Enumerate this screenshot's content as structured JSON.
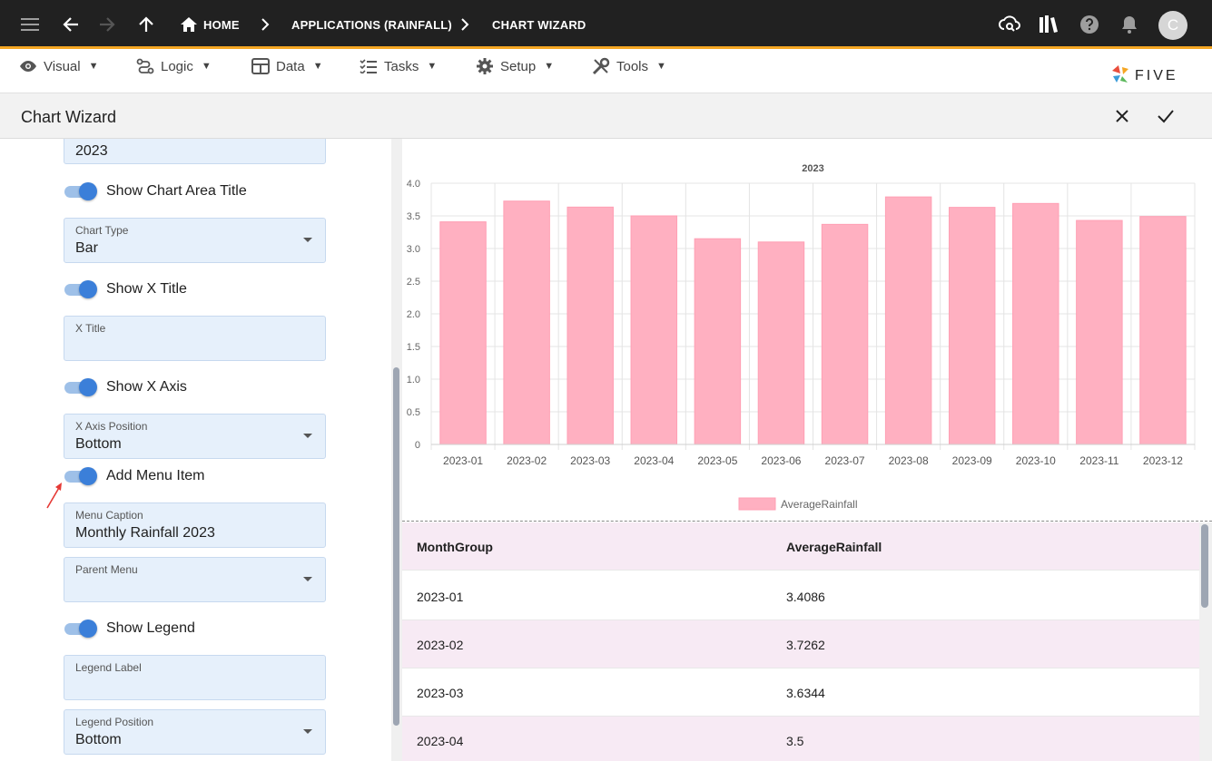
{
  "topbar": {
    "breadcrumbs": [
      "HOME",
      "APPLICATIONS (RAINFALL)",
      "CHART WIZARD"
    ],
    "avatar_letter": "C",
    "accent_color": "#f5a623"
  },
  "menubar": {
    "items": [
      {
        "label": "Visual",
        "icon": "eye-icon"
      },
      {
        "label": "Logic",
        "icon": "logic-icon"
      },
      {
        "label": "Data",
        "icon": "table-icon"
      },
      {
        "label": "Tasks",
        "icon": "tasks-icon"
      },
      {
        "label": "Setup",
        "icon": "gear-icon"
      },
      {
        "label": "Tools",
        "icon": "tools-icon"
      }
    ],
    "logo_text": "FIVE"
  },
  "titlebar": {
    "title": "Chart Wizard"
  },
  "form": {
    "chart_area_title_value": "2023",
    "show_chart_area_title": {
      "label": "Show Chart Area Title",
      "on": true
    },
    "chart_type": {
      "label": "Chart Type",
      "value": "Bar"
    },
    "show_x_title": {
      "label": "Show X Title",
      "on": true
    },
    "x_title": {
      "label": "X Title",
      "value": ""
    },
    "show_x_axis": {
      "label": "Show X Axis",
      "on": true
    },
    "x_axis_position": {
      "label": "X Axis Position",
      "value": "Bottom"
    },
    "add_menu_item": {
      "label": "Add Menu Item",
      "on": true
    },
    "menu_caption": {
      "label": "Menu Caption",
      "value": "Monthly Rainfall 2023"
    },
    "parent_menu": {
      "label": "Parent Menu",
      "value": ""
    },
    "show_legend": {
      "label": "Show Legend",
      "on": true
    },
    "legend_label": {
      "label": "Legend Label",
      "value": ""
    },
    "legend_position": {
      "label": "Legend Position",
      "value": "Bottom"
    }
  },
  "chart_data": {
    "type": "bar",
    "title": "2023",
    "categories": [
      "2023-01",
      "2023-02",
      "2023-03",
      "2023-04",
      "2023-05",
      "2023-06",
      "2023-07",
      "2023-08",
      "2023-09",
      "2023-10",
      "2023-11",
      "2023-12"
    ],
    "series": [
      {
        "name": "AverageRainfall",
        "values": [
          3.4086,
          3.7262,
          3.6344,
          3.5,
          3.15,
          3.1,
          3.37,
          3.79,
          3.63,
          3.69,
          3.43,
          3.49
        ],
        "color": "#ffb0c1"
      }
    ],
    "ylim": [
      0,
      4.0
    ],
    "yticks": [
      "0",
      "0.5",
      "1.0",
      "1.5",
      "2.0",
      "2.5",
      "3.0",
      "3.5",
      "4.0"
    ],
    "xlabel": "",
    "ylabel": "",
    "grid": true,
    "legend_position": "bottom"
  },
  "table": {
    "headers": [
      "MonthGroup",
      "AverageRainfall"
    ],
    "rows": [
      [
        "2023-01",
        "3.4086"
      ],
      [
        "2023-02",
        "3.7262"
      ],
      [
        "2023-03",
        "3.6344"
      ],
      [
        "2023-04",
        "3.5"
      ]
    ]
  }
}
